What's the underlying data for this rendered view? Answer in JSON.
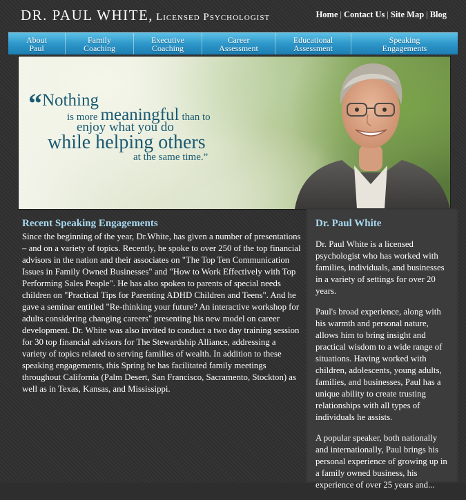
{
  "header": {
    "name": "DR. PAUL WHITE,",
    "subtitle": "Licensed Psychologist",
    "links": [
      "Home",
      "Contact Us",
      "Site Map",
      "Blog"
    ],
    "separator": "|"
  },
  "nav": {
    "items": [
      {
        "line1": "About",
        "line2": "Paul"
      },
      {
        "line1": "Family",
        "line2": "Coaching"
      },
      {
        "line1": "Executive",
        "line2": "Coaching"
      },
      {
        "line1": "Career",
        "line2": "Assessment"
      },
      {
        "line1": "Educational",
        "line2": "Assessment"
      },
      {
        "line1": "Speaking",
        "line2": "Engagements"
      }
    ]
  },
  "hero": {
    "quote": {
      "open_mark": "“",
      "w_nothing": "Nothing",
      "w_is_more": "is more",
      "w_meaningful": "meaningful",
      "w_than_to": "than to",
      "w_enjoy": "enjoy what you do",
      "w_while": "while helping others",
      "w_same_time": "at the same time.",
      "close_mark": "”"
    },
    "quote_color": "#1a5a72"
  },
  "main": {
    "heading": "Recent Speaking Engagements",
    "body": "Since the beginning of the year, Dr.White, has given a number of presentations – and on a variety of topics. Recently, he spoke to over 250 of the top financial advisors in the nation and their associates on \"The Top Ten Communication Issues in Family Owned Businesses\" and \"How to Work Effectively with Top Performing Sales People\". He has also spoken to parents of special needs children on \"Practical Tips for Parenting ADHD Children and Teens\". And he gave a seminar entitled \"Re-thinking your future? An interactive workshop for adults considering changing careers\" presenting his new model on career development. Dr. White was also invited to conduct a two day training session for 30 top financial advisors for The Stewardship Alliance, addressing a variety of topics related to serving families of wealth. In addition to these speaking engagements, this Spring he has facilitated family meetings throughout California (Palm Desert, San Francisco, Sacramento, Stockton) as well as in Texas, Kansas, and Mississippi."
  },
  "sidebar": {
    "heading": "Dr. Paul White",
    "paragraphs": [
      "Dr. Paul White is a licensed psychologist who has worked with families, individuals, and businesses in a variety of settings for over 20 years.",
      "Paul's broad experience, along with his warmth and personal nature, allows him to bring insight and practical wisdom to a wide range of situations. Having worked with children, adolescents, young adults, families, and businesses, Paul has a unique ability to create trusting relationships with all types of individuals he assists.",
      "A popular speaker, both nationally and internationally, Paul brings his personal experience of growing up in a family owned business, his experience of over 25 years and..."
    ]
  },
  "colors": {
    "accent_heading": "#a9d9ef",
    "nav_blue": "#2e97c9",
    "background": "#303030",
    "sidebar_bg": "#3c3c3c"
  }
}
